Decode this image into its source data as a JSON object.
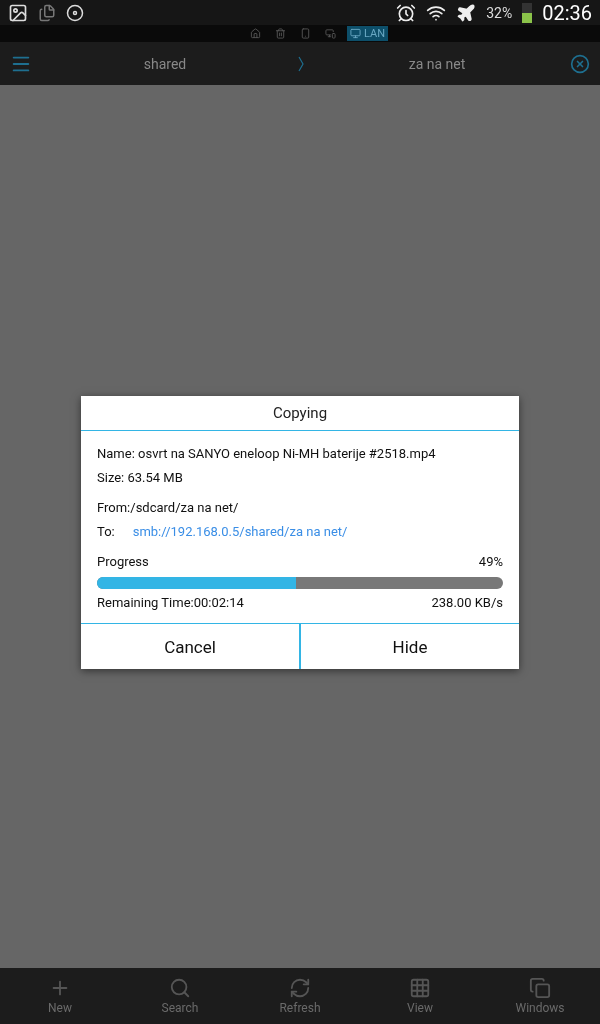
{
  "status_bar": {
    "battery": "32%",
    "time": "02:36"
  },
  "location_tabs": [
    {
      "kind": "home",
      "selected": false
    },
    {
      "kind": "trash",
      "selected": false
    },
    {
      "kind": "device",
      "selected": false
    },
    {
      "kind": "devices",
      "selected": false
    },
    {
      "kind": "network",
      "label": "LAN",
      "selected": true
    }
  ],
  "path_bar": {
    "crumbs": [
      "shared",
      "za na net"
    ]
  },
  "dialog": {
    "title": "Copying",
    "name": "Name: osvrt na SANYO eneloop Ni-MH baterije #2518.mp4",
    "size": "Size: 63.54 MB",
    "from": "From:/sdcard/za na net/",
    "to_label": "To:",
    "to_path": "smb://192.168.0.5/shared/za na net/",
    "progress_label": "Progress",
    "percent": "49%",
    "level": 0.49,
    "remaining": "Remaining Time:00:02:14",
    "speed": "238.00 KB/s",
    "buttons": [
      "Cancel",
      "Hide"
    ]
  },
  "bottom_bar": [
    {
      "kind": "new",
      "label": "New"
    },
    {
      "kind": "search",
      "label": "Search"
    },
    {
      "kind": "refresh",
      "label": "Refresh"
    },
    {
      "kind": "view",
      "label": "View"
    },
    {
      "kind": "windows",
      "label": "Windows"
    }
  ]
}
